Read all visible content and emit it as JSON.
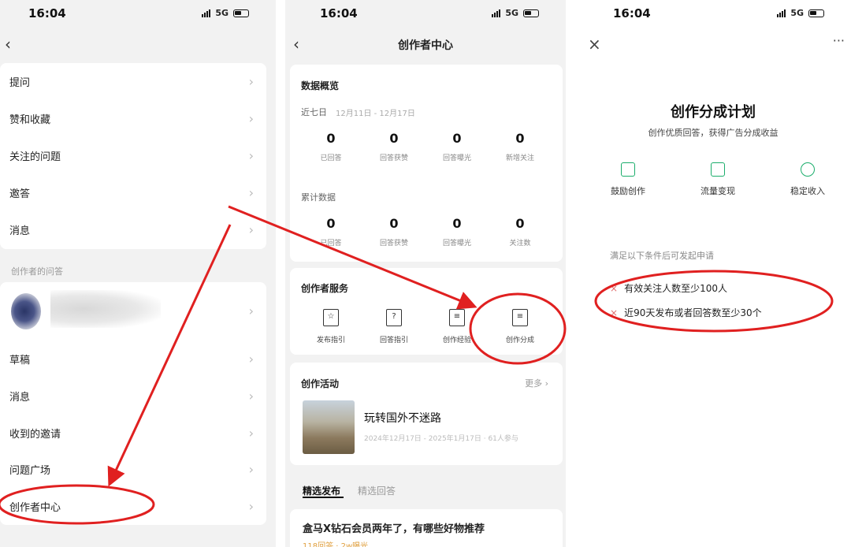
{
  "status": {
    "time": "16:04",
    "network": "5G"
  },
  "screen1": {
    "menu_top": [
      {
        "label": "提问"
      },
      {
        "label": "赞和收藏"
      },
      {
        "label": "关注的问题"
      },
      {
        "label": "邀答"
      },
      {
        "label": "消息"
      }
    ],
    "section_label": "创作者的问答",
    "menu_bottom": [
      {
        "label": "草稿"
      },
      {
        "label": "消息"
      },
      {
        "label": "收到的邀请"
      },
      {
        "label": "问题广场"
      },
      {
        "label": "创作者中心"
      }
    ]
  },
  "screen2": {
    "title": "创作者中心",
    "overview": {
      "heading": "数据概览",
      "recent_label": "近七日",
      "recent_range": "12月11日 - 12月17日",
      "recent_stats": [
        {
          "value": "0",
          "label": "已回答"
        },
        {
          "value": "0",
          "label": "回答获赞"
        },
        {
          "value": "0",
          "label": "回答曝光"
        },
        {
          "value": "0",
          "label": "新增关注"
        }
      ],
      "total_label": "累计数据",
      "total_stats": [
        {
          "value": "0",
          "label": "已回答"
        },
        {
          "value": "0",
          "label": "回答获赞"
        },
        {
          "value": "0",
          "label": "回答曝光"
        },
        {
          "value": "0",
          "label": "关注数"
        }
      ]
    },
    "services": {
      "heading": "创作者服务",
      "items": [
        {
          "label": "发布指引",
          "icon": "book-star-icon"
        },
        {
          "label": "回答指引",
          "icon": "book-question-icon"
        },
        {
          "label": "创作经验",
          "icon": "note-edit-icon"
        },
        {
          "label": "创作分成",
          "icon": "doc-money-icon"
        }
      ]
    },
    "activity": {
      "heading": "创作活动",
      "more": "更多",
      "title": "玩转国外不迷路",
      "meta": "2024年12月17日 - 2025年1月17日 · 61人参与"
    },
    "tabs": [
      "精选发布",
      "精选回答"
    ],
    "post": {
      "title": "盒马X钻石会员两年了，有哪些好物推荐",
      "meta": "118回答 · 2w曝光"
    }
  },
  "screen3": {
    "title": "创作分成计划",
    "subtitle": "创作优质回答，获得广告分成收益",
    "benefits": [
      {
        "label": "鼓励创作",
        "icon": "edit-square-icon"
      },
      {
        "label": "流量变现",
        "icon": "trend-chart-icon"
      },
      {
        "label": "稳定收入",
        "icon": "shield-coin-icon"
      }
    ],
    "requirements_label": "满足以下条件后可发起申请",
    "requirements": [
      {
        "label": "有效关注人数至少100人"
      },
      {
        "label": "近90天发布或者回答数至少30个"
      }
    ]
  },
  "colors": {
    "accent_green": "#1aad6b",
    "annotation_red": "#e02020"
  }
}
